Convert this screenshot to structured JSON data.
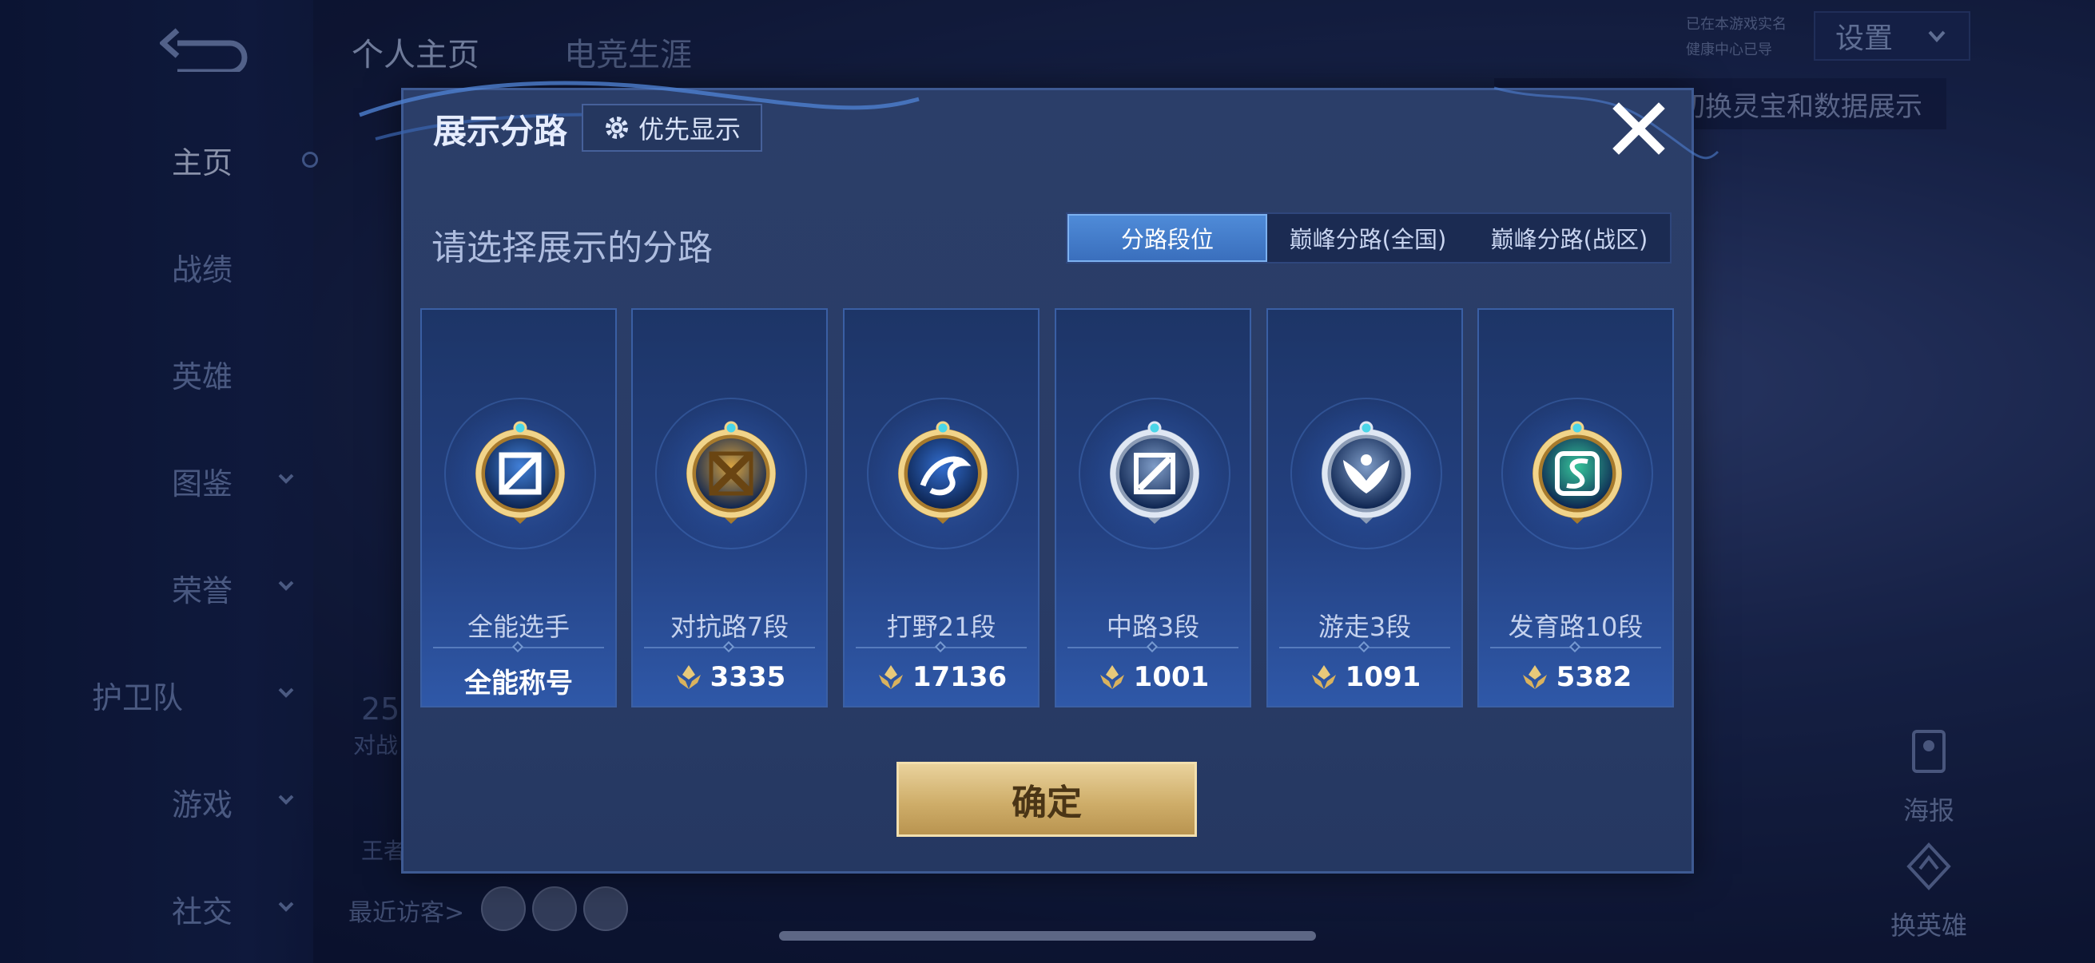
{
  "left_nav": {
    "items": [
      {
        "label": "主页",
        "active": true,
        "has_chevron": false
      },
      {
        "label": "战绩",
        "active": false,
        "has_chevron": false
      },
      {
        "label": "英雄",
        "active": false,
        "has_chevron": false
      },
      {
        "label": "图鉴",
        "active": false,
        "has_chevron": true
      },
      {
        "label": "荣誉",
        "active": false,
        "has_chevron": true
      },
      {
        "label": "护卫队",
        "active": false,
        "has_chevron": true
      },
      {
        "label": "游戏",
        "active": false,
        "has_chevron": true
      },
      {
        "label": "社交",
        "active": false,
        "has_chevron": true
      }
    ]
  },
  "top_tabs": [
    {
      "label": "个人主页",
      "active": true
    },
    {
      "label": "电竞生涯",
      "active": false
    }
  ],
  "settings": {
    "label": "设置",
    "tags": [
      "已在本游戏实名",
      "健康中心已导"
    ]
  },
  "background_tip": "切换灵宝和数据展示",
  "side_actions": [
    {
      "label": "海报",
      "icon": "poster-icon"
    },
    {
      "label": "换英雄",
      "icon": "switch-hero-icon"
    }
  ],
  "ghost": {
    "number": "25",
    "battles": "对战",
    "king": "王者"
  },
  "recent_visitors_label": "最近访客>",
  "modal": {
    "title": "展示分路",
    "priority_label": "优先显示",
    "prompt": "请选择展示的分路",
    "segments": [
      {
        "label": "分路段位",
        "active": true
      },
      {
        "label": "巅峰分路(全国)",
        "active": false
      },
      {
        "label": "巅峰分路(战区)",
        "active": false
      }
    ],
    "cards": [
      {
        "name": "全能选手",
        "score": "全能称号",
        "badge": "all-round-badge-icon",
        "color": "#3b7fe0",
        "show_score_icon": false
      },
      {
        "name": "对抗路7段",
        "score": "3335",
        "badge": "clash-lane-badge-icon",
        "color": "#d9a441",
        "show_score_icon": true
      },
      {
        "name": "打野21段",
        "score": "17136",
        "badge": "jungle-dragon-badge-icon",
        "color": "#2c6cd6",
        "show_score_icon": true
      },
      {
        "name": "中路3段",
        "score": "1001",
        "badge": "mid-lane-badge-icon",
        "color": "#7e9cc8",
        "show_score_icon": true
      },
      {
        "name": "游走3段",
        "score": "1091",
        "badge": "roam-wings-badge-icon",
        "color": "#7e9cc8",
        "show_score_icon": true
      },
      {
        "name": "发育路10段",
        "score": "5382",
        "badge": "farm-lane-badge-icon",
        "color": "#2fc7a0",
        "show_score_icon": true
      }
    ],
    "confirm_label": "确定"
  },
  "colors": {
    "modal_bg": "#2b3e69",
    "segment_active": "#4f8bd8",
    "gold": "#d7b36c"
  }
}
